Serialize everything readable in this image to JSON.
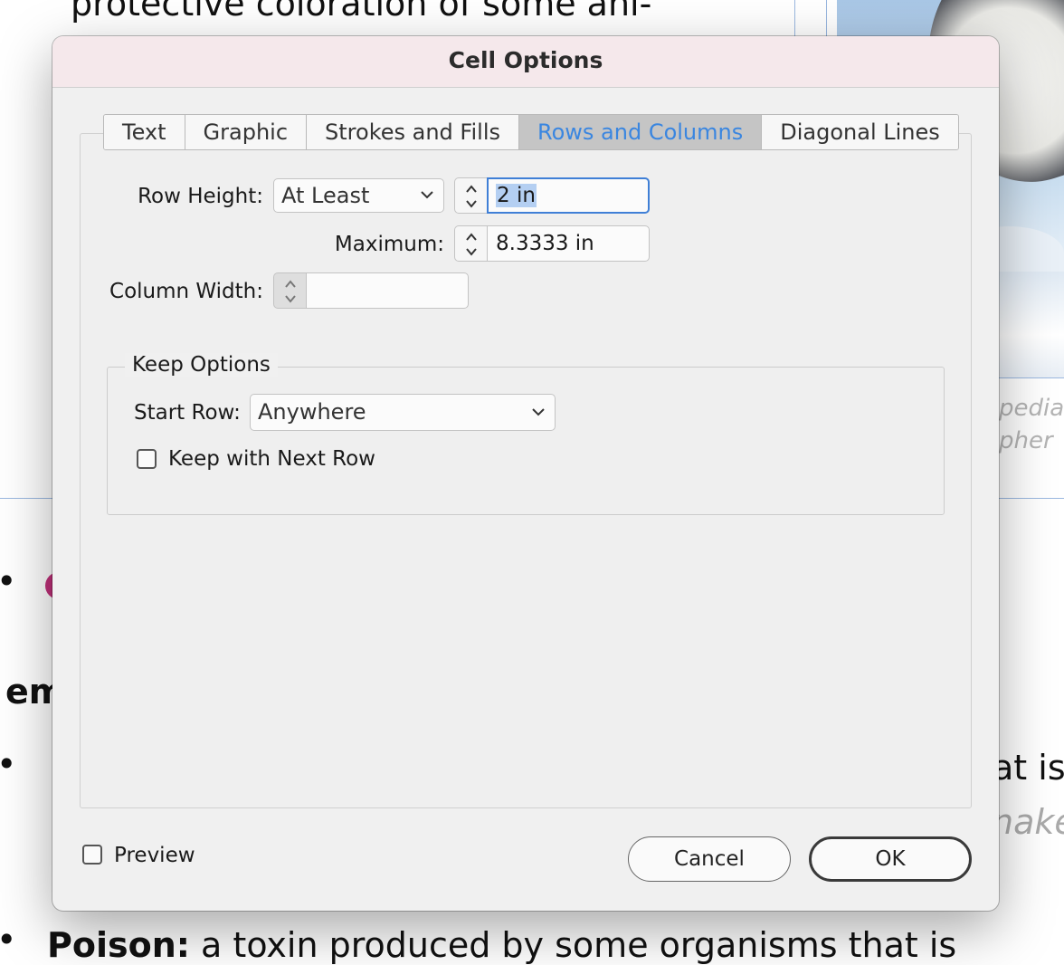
{
  "background_document": {
    "line_top": "protective coloration of some ani-",
    "caption_line1": "pedia",
    "caption_line2": "pher",
    "bold_heading_fragment": "em",
    "bullet_text_right": "at is",
    "italic_text_right": "nake",
    "poison_term": "Poison:",
    "poison_text": " a toxin produced by some organisms that is"
  },
  "dialog": {
    "title": "Cell Options",
    "tabs": [
      {
        "label": "Text",
        "active": false
      },
      {
        "label": "Graphic",
        "active": false
      },
      {
        "label": "Strokes and Fills",
        "active": false
      },
      {
        "label": "Rows and Columns",
        "active": true
      },
      {
        "label": "Diagonal Lines",
        "active": false
      }
    ],
    "row_height": {
      "label": "Row Height:",
      "mode": "At Least",
      "value": "2 in"
    },
    "maximum": {
      "label": "Maximum:",
      "value": "8.3333 in"
    },
    "column_width": {
      "label": "Column Width:",
      "value": ""
    },
    "keep_options": {
      "title": "Keep Options",
      "start_row_label": "Start Row:",
      "start_row_value": "Anywhere",
      "keep_with_next_label": "Keep with Next Row",
      "keep_with_next_checked": false
    },
    "preview": {
      "label": "Preview",
      "checked": false
    },
    "buttons": {
      "cancel": "Cancel",
      "ok": "OK"
    }
  },
  "colors": {
    "active_tab_text": "#3a86e0",
    "title_bar": "#f5e8eb",
    "focus_ring": "#3f7fd6",
    "bullet_accent": "#c0307a"
  }
}
